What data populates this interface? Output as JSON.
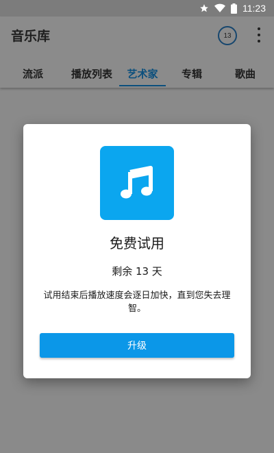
{
  "status_bar": {
    "time": "11:23",
    "icons": [
      "star-icon",
      "wifi-icon",
      "battery-icon"
    ]
  },
  "app_bar": {
    "title": "音乐库",
    "counter": "13",
    "tabs": [
      {
        "label": "流派",
        "active": false
      },
      {
        "label": "播放列表",
        "active": false
      },
      {
        "label": "艺术家",
        "active": true
      },
      {
        "label": "专辑",
        "active": false
      },
      {
        "label": "歌曲",
        "active": false
      }
    ]
  },
  "dialog": {
    "icon": "music-note-icon",
    "title": "免费试用",
    "remaining": "剩余 13 天",
    "description": "试用结束后播放速度会逐日加快，直到您失去理智。",
    "upgrade_label": "升级"
  },
  "colors": {
    "accent": "#0ba6ef",
    "button": "#0b97e8",
    "active_tab": "#0b4f7d",
    "scrim": "#8a8a8a"
  }
}
